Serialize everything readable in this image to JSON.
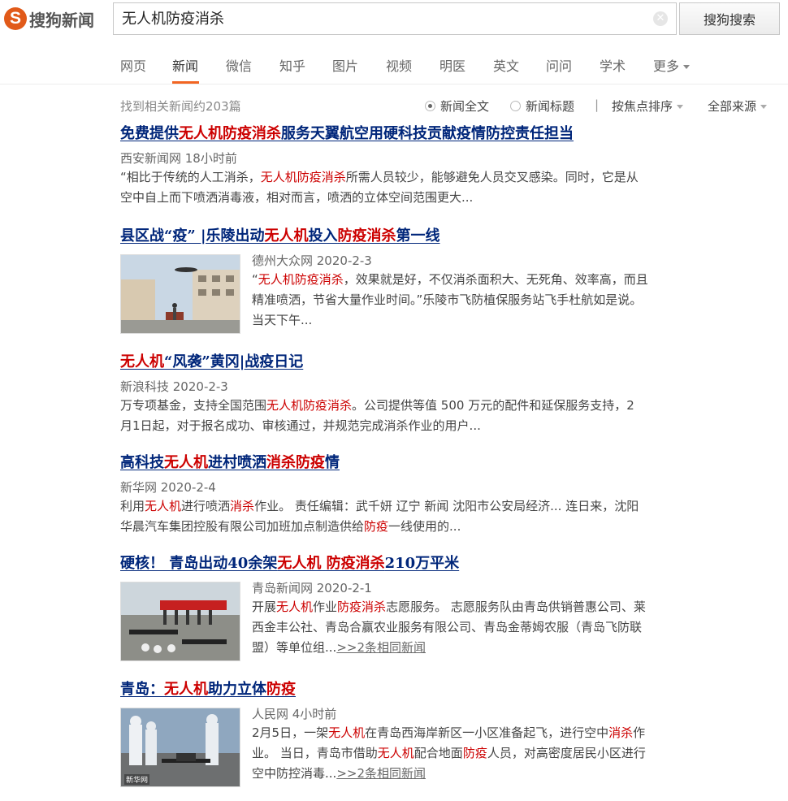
{
  "logo": {
    "text": "搜狗新闻"
  },
  "search": {
    "query": "无人机防疫消杀",
    "button": "搜狗搜索"
  },
  "nav": {
    "items": [
      "网页",
      "新闻",
      "微信",
      "知乎",
      "图片",
      "视频",
      "明医",
      "英文",
      "问问",
      "学术",
      "更多"
    ],
    "active": "新闻"
  },
  "toolbar": {
    "count": "找到相关新闻约203篇",
    "opt_full": "新闻全文",
    "opt_title": "新闻标题",
    "sep": "|",
    "sort": "按焦点排序",
    "source": "全部来源"
  },
  "results": [
    {
      "title": [
        [
          "免费提供",
          0
        ],
        [
          "无人机防疫消杀",
          1
        ],
        [
          "服务天翼航空用硬科技贡献疫情防控责任担当",
          0
        ]
      ],
      "meta": "西安新闻网 18小时前",
      "snippet_lines": [
        [
          [
            "“相比于传统的人工消杀，",
            0
          ],
          [
            "无人机防疫消杀",
            1
          ],
          [
            "所需人员较少，能够避免人员交叉感染。同时，它是从",
            0
          ]
        ],
        [
          [
            "空中自上而下喷洒消毒液，相对而言，喷洒的立体空间范围更大...",
            0
          ]
        ]
      ],
      "image": false
    },
    {
      "title": [
        [
          "县区战“疫” |乐陵出动",
          0
        ],
        [
          "无人机",
          1
        ],
        [
          "投入",
          0
        ],
        [
          "防疫消杀",
          1
        ],
        [
          "第一线",
          0
        ]
      ],
      "meta": "德州大众网 2020-2-3",
      "snippet_lines": [
        [
          [
            "“",
            0
          ],
          [
            "无人机防疫消杀",
            1
          ],
          [
            "，效果就是好，不仅消杀面积大、无死角、效率高，而且",
            0
          ]
        ],
        [
          [
            "精准喷洒，节省大量作业时间。”乐陵市飞防植保服务站飞手杜航如是说。",
            0
          ]
        ],
        [
          [
            "当天下午...",
            0
          ]
        ]
      ],
      "image": true,
      "image_caption": ""
    },
    {
      "title": [
        [
          "无人机",
          1
        ],
        [
          "“风袭”黄冈|战疫日记",
          0
        ]
      ],
      "meta": "新浪科技 2020-2-3",
      "snippet_lines": [
        [
          [
            "万专项基金，支持全国范围",
            0
          ],
          [
            "无人机防疫消杀",
            1
          ],
          [
            "。公司提供等值 500 万元的配件和延保服务支持，2",
            0
          ]
        ],
        [
          [
            "月1日起，对于报名成功、审核通过，并规范完成消杀作业的用户...",
            0
          ]
        ]
      ],
      "image": false
    },
    {
      "title": [
        [
          "高科技",
          0
        ],
        [
          "无人机",
          1
        ],
        [
          "进村喷洒",
          0
        ],
        [
          "消杀防疫",
          1
        ],
        [
          "情",
          0
        ]
      ],
      "meta": "新华网 2020-2-4",
      "snippet_lines": [
        [
          [
            "利用",
            0
          ],
          [
            "无人机",
            1
          ],
          [
            "进行喷洒",
            0
          ],
          [
            "消杀",
            1
          ],
          [
            "作业。 责任编辑：武千妍 辽宁 新闻 沈阳市公安局经济... 连日来，沈阳",
            0
          ]
        ],
        [
          [
            "华晨汽车集团控股有限公司加班加点制造供给",
            0
          ],
          [
            "防疫",
            1
          ],
          [
            "一线使用的...",
            0
          ]
        ]
      ],
      "image": false
    },
    {
      "title": [
        [
          "硬核！ 青岛出动40余架",
          0
        ],
        [
          "无人机 防疫消杀",
          1
        ],
        [
          "210万平米",
          0
        ]
      ],
      "meta": "青岛新闻网 2020-2-1",
      "snippet_lines": [
        [
          [
            "开展",
            0
          ],
          [
            "无人机",
            1
          ],
          [
            "作业",
            0
          ],
          [
            "防疫消杀",
            1
          ],
          [
            "志愿服务。 志愿服务队由青岛供销普惠公司、莱",
            0
          ]
        ],
        [
          [
            "西金丰公社、青岛合赢农业服务有限公司、青岛金蒂姆农服（青岛飞防联",
            0
          ]
        ],
        [
          [
            "盟）等单位组...",
            0
          ]
        ]
      ],
      "more": ">>2条相同新闻",
      "image": true
    },
    {
      "title": [
        [
          "青岛：",
          0
        ],
        [
          "无人机",
          1
        ],
        [
          "助力立体",
          0
        ],
        [
          "防疫",
          1
        ]
      ],
      "meta": "人民网 4小时前",
      "snippet_lines": [
        [
          [
            "2月5日，一架",
            0
          ],
          [
            "无人机",
            1
          ],
          [
            "在青岛西海岸新区一小区准备起飞，进行空中",
            0
          ],
          [
            "消杀",
            1
          ],
          [
            "作",
            0
          ]
        ],
        [
          [
            "业。 当日，青岛市借助",
            0
          ],
          [
            "无人机",
            1
          ],
          [
            "配合地面",
            0
          ],
          [
            "防疫",
            1
          ],
          [
            "人员，对高密度居民小区进行",
            0
          ]
        ],
        [
          [
            "空中防控消毒...",
            0
          ]
        ]
      ],
      "more": ">>2条相同新闻",
      "image": true,
      "image_caption": "新华网"
    }
  ]
}
